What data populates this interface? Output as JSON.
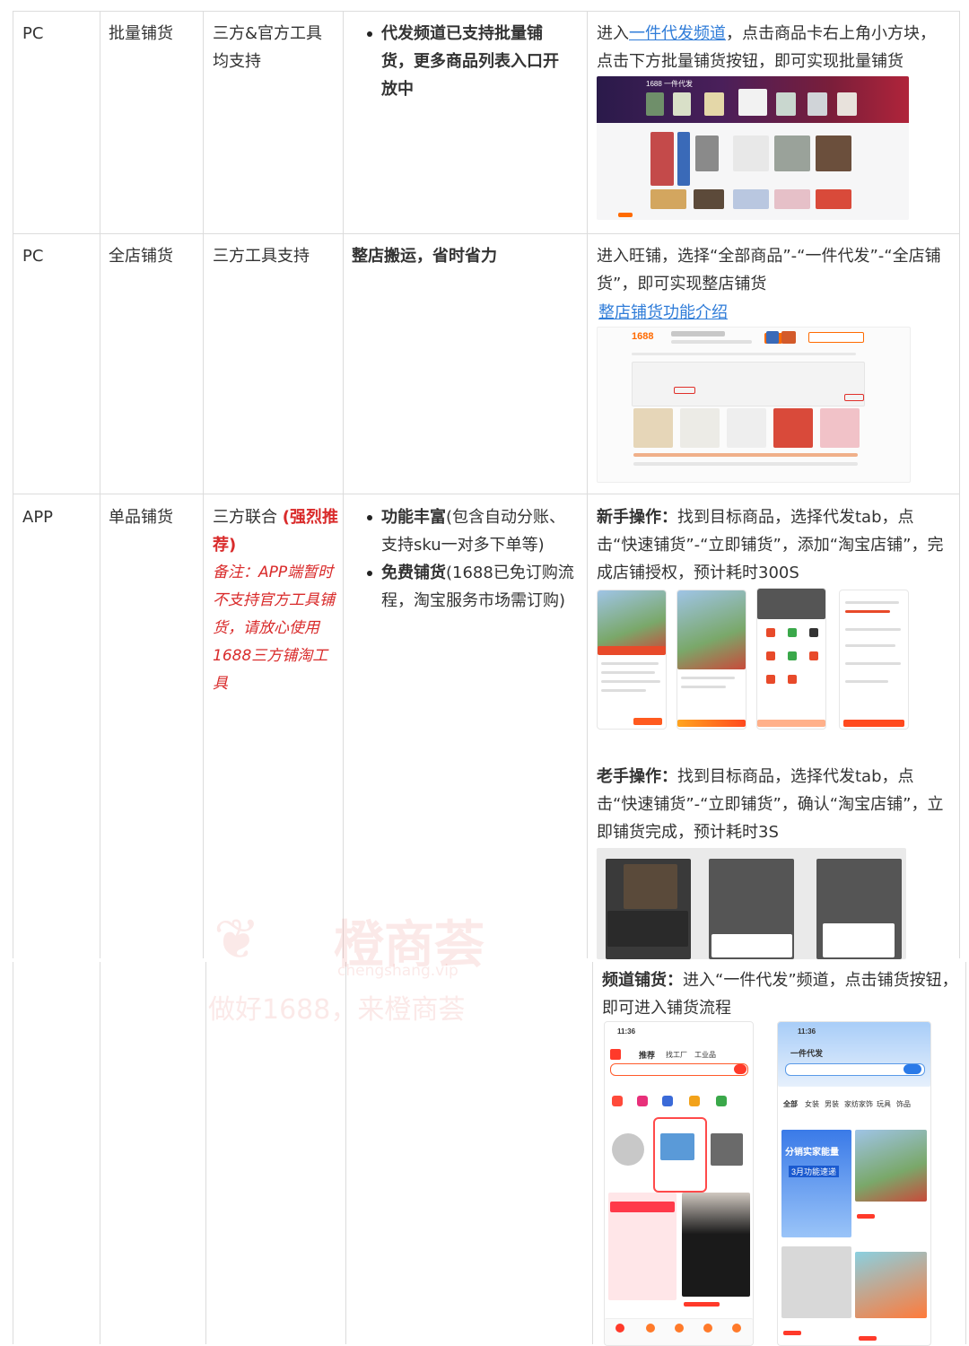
{
  "rows": [
    {
      "platform": "PC",
      "type": "批量铺货",
      "tool": "三方&官方工具均支持",
      "feature_bold": "代发频道已支持批量铺货，更多商品列表入口开放中",
      "op_pre": "进入",
      "op_link": "一件代发频道",
      "op_post": "，点击商品卡右上角小方块，点击下方批量铺货按钮，即可实现批量铺货"
    },
    {
      "platform": "PC",
      "type": "全店铺货",
      "tool": "三方工具支持",
      "feature_bold": "整店搬运，省时省力",
      "op_text": "进入旺铺，选择“全部商品”-“一件代发”-“全店铺货”，即可实现整店铺货",
      "op_link": "整店铺货功能介绍"
    },
    {
      "platform": "APP",
      "type": "单品铺货",
      "tool_main": "三方联合",
      "tool_recommend": "(强烈推荐)",
      "tool_note": "备注：APP端暂时不支持官方工具铺货，请放心使用1688三方铺淘工具",
      "bullet1_bold": "功能丰富",
      "bullet1_text": "(包含自动分账、支持sku一对多下单等)",
      "bullet2_bold": "免费铺货",
      "bullet2_text": "(1688已免订购流程，淘宝服务市场需订购)",
      "novice_label": "新手操作：",
      "novice_text": "找到目标商品，选择代发tab，点击“快速铺货”-“立即铺货”，添加“淘宝店铺”，完成店铺授权，预计耗时300S",
      "expert_label": "老手操作：",
      "expert_text": "找到目标商品，选择代发tab，点击“快速铺货”-“立即铺货”，确认“淘宝店铺”，立即铺货完成，预计耗时3S",
      "channel_label": "频道铺货：",
      "channel_text": "进入“一件代发”频道，点击铺货按钮，即可进入铺货流程"
    }
  ],
  "screenshots": {
    "logo": "1688",
    "pc_header": "1688 一件代发",
    "phone_time_left": "11:36",
    "phone_time_right": "11:36",
    "phone_right_title": "一件代发",
    "phone_banner1": "分销实家能量",
    "phone_banner2": "3月功能速递",
    "phone_tabs": [
      "推荐",
      "找工厂",
      "工业品"
    ],
    "phone_right_tabs": [
      "全部",
      "女装",
      "男装",
      "家纺家饰",
      "玩具",
      "饰品"
    ]
  },
  "watermark": {
    "brand": "橙商荟",
    "url": "chengshang.vip",
    "slogan": "做好1688，来橙商荟"
  },
  "colors": {
    "accent_red": "#d92b2b",
    "link_blue": "#2f7cd8",
    "brand_orange": "#ff6a00",
    "grid": "#dcdcdc"
  }
}
